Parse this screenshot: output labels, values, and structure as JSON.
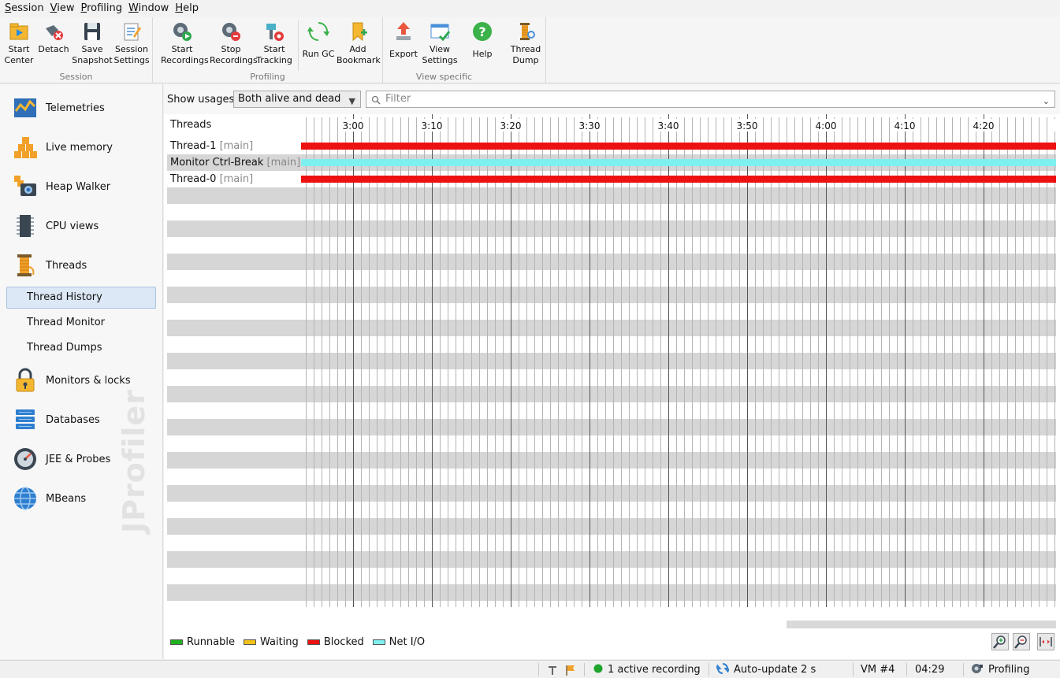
{
  "menu": [
    {
      "label": "Session",
      "accel": "S",
      "rest": "ession"
    },
    {
      "label": "View",
      "accel": "V",
      "rest": "iew"
    },
    {
      "label": "Profiling",
      "accel": "P",
      "rest": "rofiling"
    },
    {
      "label": "Window",
      "accel": "W",
      "rest": "indow"
    },
    {
      "label": "Help",
      "accel": "H",
      "rest": "elp"
    }
  ],
  "toolbar": {
    "groups": {
      "session": "Session",
      "profiling": "Profiling",
      "view_specific": "View specific"
    },
    "start_center": "Start\nCenter",
    "detach": "Detach",
    "save_snapshot": "Save\nSnapshot",
    "session_settings": "Session\nSettings",
    "start_recordings": "Start\nRecordings",
    "stop_recordings": "Stop\nRecordings",
    "start_tracking": "Start\nTracking",
    "run_gc": "Run GC",
    "add_bookmark": "Add\nBookmark",
    "export": "Export",
    "view_settings": "View\nSettings",
    "help": "Help",
    "thread_dump": "Thread\nDump"
  },
  "sidebar": {
    "items": {
      "telemetries": "Telemetries",
      "live_memory": "Live memory",
      "heap_walker": "Heap Walker",
      "cpu_views": "CPU views",
      "threads": "Threads",
      "monitors_locks": "Monitors & locks",
      "databases": "Databases",
      "jee_probes": "JEE & Probes",
      "mbeans": "MBeans"
    },
    "subitems": {
      "thread_history": "Thread History",
      "thread_monitor": "Thread Monitor",
      "thread_dumps": "Thread Dumps"
    },
    "selected": "Thread History",
    "watermark": "JProfiler"
  },
  "filterbar": {
    "show_usages_label": "Show usages:",
    "show_usages_value": "Both alive and dead",
    "filter_placeholder": "Filter"
  },
  "timeline": {
    "header": "Threads",
    "ticks": [
      "3:00",
      "3:10",
      "3:20",
      "3:30",
      "3:40",
      "3:50",
      "4:00",
      "4:10",
      "4:20",
      "4"
    ],
    "threads": [
      {
        "name": "Thread-1",
        "group": "[main]",
        "state": "Blocked"
      },
      {
        "name": "Monitor Ctrl-Break",
        "group": "[main]",
        "state": "Net I/O"
      },
      {
        "name": "Thread-0",
        "group": "[main]",
        "state": "Blocked"
      }
    ]
  },
  "legend": [
    {
      "label": "Runnable",
      "color": "#1fb21f"
    },
    {
      "label": "Waiting",
      "color": "#f3c21a"
    },
    {
      "label": "Blocked",
      "color": "#ee1111"
    },
    {
      "label": "Net I/O",
      "color": "#7ff0f0"
    }
  ],
  "statusbar": {
    "recording": "1 active recording",
    "auto_update": "Auto-update 2 s",
    "vm": "VM #4",
    "time": "04:29",
    "mode": "Profiling"
  }
}
